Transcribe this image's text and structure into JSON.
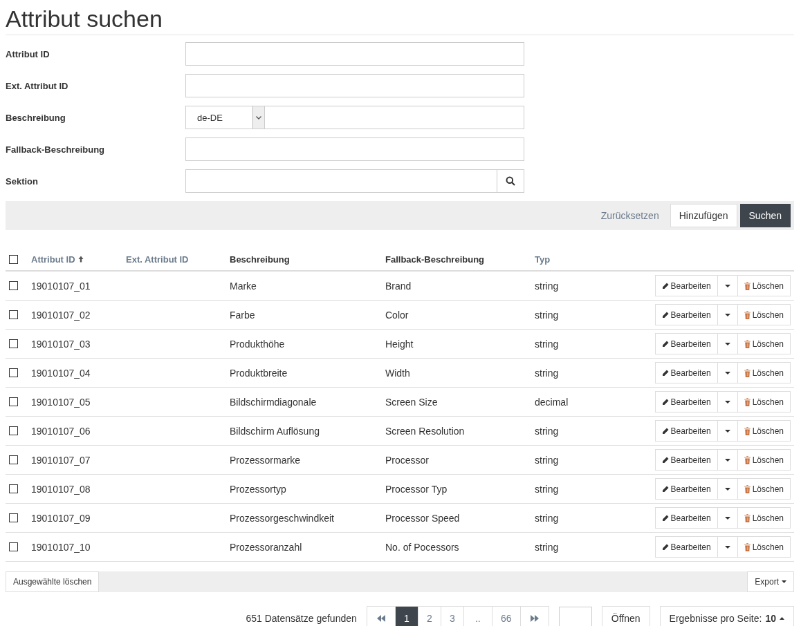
{
  "title": "Attribut suchen",
  "form": [
    {
      "label": "Attribut ID",
      "kind": "text"
    },
    {
      "label": "Ext. Attribut ID",
      "kind": "text"
    },
    {
      "label": "Beschreibung",
      "kind": "language",
      "language": "de-DE"
    },
    {
      "label": "Fallback-Beschreibung",
      "kind": "text"
    },
    {
      "label": "Sektion",
      "kind": "lookup"
    }
  ],
  "actions": {
    "reset": "Zurücksetzen",
    "add": "Hinzufügen",
    "search": "Suchen"
  },
  "table": {
    "select_all_checked": false,
    "columns": [
      {
        "label": "Attribut ID",
        "sortable": true,
        "sorted": true
      },
      {
        "label": "Ext. Attribut ID",
        "sortable": true,
        "sorted": false
      },
      {
        "label": "Beschreibung",
        "sortable": false,
        "sorted": false
      },
      {
        "label": "Fallback-Beschreibung",
        "sortable": false,
        "sorted": false
      },
      {
        "label": "Typ",
        "sortable": true,
        "sorted": false
      }
    ],
    "rows": [
      {
        "checked": false,
        "id": "19010107_01",
        "description": "Marke",
        "fallback": "Brand",
        "type": "string",
        "edit": "Bearbeiten",
        "delete": "Löschen"
      },
      {
        "checked": false,
        "id": "19010107_02",
        "description": "Farbe",
        "fallback": "Color",
        "type": "string",
        "edit": "Bearbeiten",
        "delete": "Löschen"
      },
      {
        "checked": false,
        "id": "19010107_03",
        "description": "Produkthöhe",
        "fallback": "Height",
        "type": "string",
        "edit": "Bearbeiten",
        "delete": "Löschen"
      },
      {
        "checked": false,
        "id": "19010107_04",
        "description": "Produktbreite",
        "fallback": "Width",
        "type": "string",
        "edit": "Bearbeiten",
        "delete": "Löschen"
      },
      {
        "checked": false,
        "id": "19010107_05",
        "description": "Bildschirmdiagonale",
        "fallback": "Screen Size",
        "type": "decimal",
        "edit": "Bearbeiten",
        "delete": "Löschen"
      },
      {
        "checked": false,
        "id": "19010107_06",
        "description": "Bildschirm Auflösung",
        "fallback": "Screen Resolution",
        "type": "string",
        "edit": "Bearbeiten",
        "delete": "Löschen"
      },
      {
        "checked": false,
        "id": "19010107_07",
        "description": "Prozessormarke",
        "fallback": "Processor",
        "type": "string",
        "edit": "Bearbeiten",
        "delete": "Löschen"
      },
      {
        "checked": false,
        "id": "19010107_08",
        "description": "Prozessortyp",
        "fallback": "Processor Typ",
        "type": "string",
        "edit": "Bearbeiten",
        "delete": "Löschen"
      },
      {
        "checked": false,
        "id": "19010107_09",
        "description": "Prozessorgeschwindkeit",
        "fallback": "Processor Speed",
        "type": "string",
        "edit": "Bearbeiten",
        "delete": "Löschen"
      },
      {
        "checked": false,
        "id": "19010107_10",
        "description": "Prozessoranzahl",
        "fallback": "No. of Pocessors",
        "type": "string",
        "edit": "Bearbeiten",
        "delete": "Löschen"
      }
    ]
  },
  "footer": {
    "delete_selected": "Ausgewählte löschen",
    "export": "Export"
  },
  "pagination": {
    "count": "651 Datensätze gefunden",
    "pages": [
      {
        "label": "1",
        "selected": true
      },
      {
        "label": "2",
        "selected": false
      },
      {
        "label": "3",
        "selected": false
      },
      {
        "label": "..",
        "selected": false
      },
      {
        "label": "66",
        "selected": false
      }
    ],
    "open": "Öffnen",
    "per_page_label": "Ergebnisse pro Seite:",
    "per_page": "10"
  }
}
